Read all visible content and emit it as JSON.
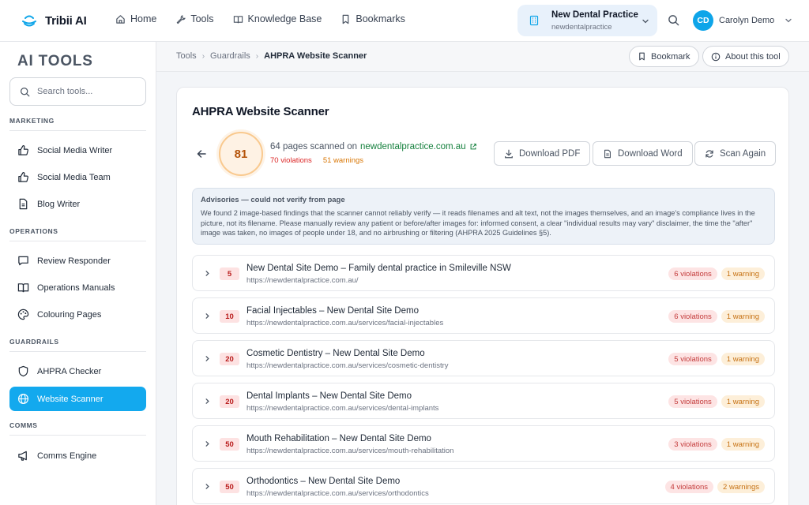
{
  "app": {
    "name": "Tribii AI"
  },
  "nav": {
    "links": [
      {
        "label": "Home",
        "icon": "home-icon"
      },
      {
        "label": "Tools",
        "icon": "wrench-icon"
      },
      {
        "label": "Knowledge Base",
        "icon": "book-icon"
      },
      {
        "label": "Bookmarks",
        "icon": "bookmark-icon"
      }
    ]
  },
  "practice": {
    "name": "New Dental Practice",
    "slug": "newdentalpractice"
  },
  "user": {
    "initials": "CD",
    "name": "Carolyn Demo"
  },
  "sidebar": {
    "title": "AI TOOLS",
    "search_placeholder": "Search tools...",
    "sections": [
      {
        "label": "MARKETING",
        "items": [
          {
            "label": "Social Media Writer",
            "icon": "thumbs-up-icon"
          },
          {
            "label": "Social Media Team",
            "icon": "thumbs-up-icon"
          },
          {
            "label": "Blog Writer",
            "icon": "document-icon"
          }
        ]
      },
      {
        "label": "OPERATIONS",
        "items": [
          {
            "label": "Review Responder",
            "icon": "chat-icon"
          },
          {
            "label": "Operations Manuals",
            "icon": "open-book-icon"
          },
          {
            "label": "Colouring Pages",
            "icon": "palette-icon"
          }
        ]
      },
      {
        "label": "GUARDRAILS",
        "items": [
          {
            "label": "AHPRA Checker",
            "icon": "shield-icon"
          },
          {
            "label": "Website Scanner",
            "icon": "globe-icon",
            "active": true
          }
        ]
      },
      {
        "label": "COMMS",
        "items": [
          {
            "label": "Comms Engine",
            "icon": "megaphone-icon"
          }
        ]
      }
    ]
  },
  "breadcrumb": {
    "items": [
      "Tools",
      "Guardrails"
    ],
    "current": "AHPRA Website Scanner"
  },
  "header_actions": {
    "bookmark": "Bookmark",
    "about": "About this tool"
  },
  "scanner": {
    "title": "AHPRA Website Scanner",
    "score": "81",
    "pages_text": "64 pages scanned on",
    "domain": "newdentalpractice.com.au",
    "violations": "70 violations",
    "warnings": "51 warnings",
    "actions": {
      "pdf": "Download PDF",
      "word": "Download Word",
      "scan": "Scan Again"
    },
    "advisory": {
      "title": "Advisories — could not verify from page",
      "text": "We found 2 image-based findings that the scanner cannot reliably verify — it reads filenames and alt text, not the images themselves, and an image's compliance lives in the picture, not its filename. Please manually review any patient or before/after images for: informed consent, a clear \"individual results may vary\" disclaimer, the time the \"after\" image was taken, no images of people under 18, and no airbrushing or filtering (AHPRA 2025 Guidelines §5)."
    },
    "pages": [
      {
        "score": "5",
        "title": "New Dental Site Demo – Family dental practice in Smileville NSW",
        "url": "https://newdentalpractice.com.au/",
        "violations": "6 violations",
        "warnings": "1 warning"
      },
      {
        "score": "10",
        "title": "Facial Injectables – New Dental Site Demo",
        "url": "https://newdentalpractice.com.au/services/facial-injectables",
        "violations": "6 violations",
        "warnings": "1 warning"
      },
      {
        "score": "20",
        "title": "Cosmetic Dentistry – New Dental Site Demo",
        "url": "https://newdentalpractice.com.au/services/cosmetic-dentistry",
        "violations": "5 violations",
        "warnings": "1 warning"
      },
      {
        "score": "20",
        "title": "Dental Implants – New Dental Site Demo",
        "url": "https://newdentalpractice.com.au/services/dental-implants",
        "violations": "5 violations",
        "warnings": "1 warning"
      },
      {
        "score": "50",
        "title": "Mouth Rehabilitation – New Dental Site Demo",
        "url": "https://newdentalpractice.com.au/services/mouth-rehabilitation",
        "violations": "3 violations",
        "warnings": "1 warning"
      },
      {
        "score": "50",
        "title": "Orthodontics – New Dental Site Demo",
        "url": "https://newdentalpractice.com.au/services/orthodontics",
        "violations": "4 violations",
        "warnings": "2 warnings"
      }
    ]
  },
  "colors": {
    "accent": "#13a9ee",
    "violation": "#dc2626",
    "warning": "#d97706",
    "domain_link": "#15803d"
  }
}
